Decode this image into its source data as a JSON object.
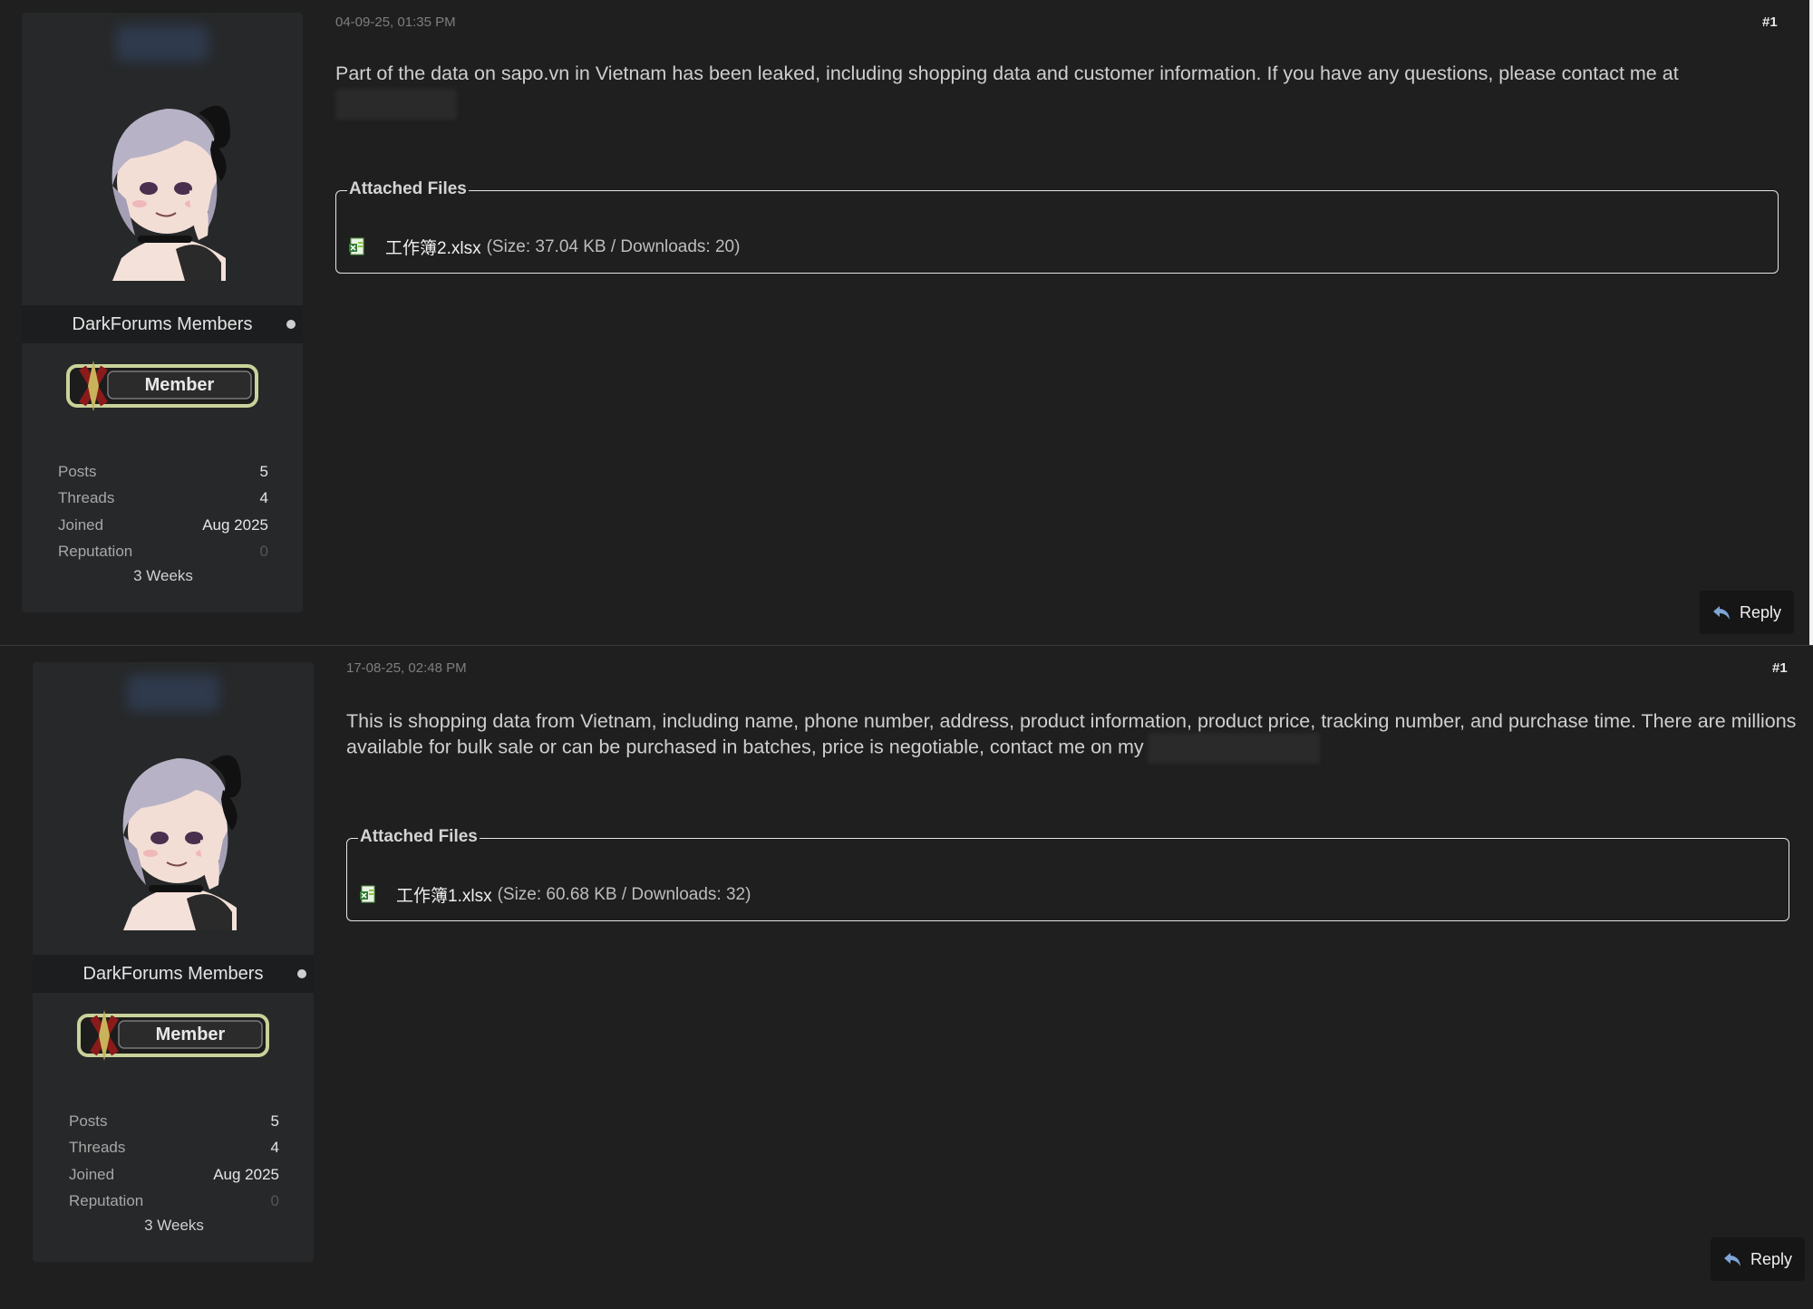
{
  "posts": [
    {
      "date": "04-09-25, 01:35 PM",
      "post_number": "#1",
      "content": "Part of the data on sapo.vn in Vietnam has been leaked, including shopping data and customer information. If you have any questions, please contact me at",
      "author": {
        "group": "DarkForums Members",
        "badge": "Member",
        "stats": [
          {
            "label": "Posts",
            "value": "5"
          },
          {
            "label": "Threads",
            "value": "4"
          },
          {
            "label": "Joined",
            "value": "Aug 2025"
          },
          {
            "label": "Reputation",
            "value": "0"
          }
        ],
        "joined_ago": "3 Weeks"
      },
      "attachments": {
        "legend": "Attached Files",
        "file_name": "工作簿2.xlsx",
        "file_meta": "(Size: 37.04 KB / Downloads: 20)"
      },
      "reply_label": "Reply"
    },
    {
      "date": "17-08-25, 02:48 PM",
      "post_number": "#1",
      "content": "This is shopping data from Vietnam, including name, phone number, address, product information, product price, tracking number, and purchase time.   There are millions available for bulk sale or can be purchased in batches, price is negotiable, contact me on my",
      "author": {
        "group": "DarkForums Members",
        "badge": "Member",
        "stats": [
          {
            "label": "Posts",
            "value": "5"
          },
          {
            "label": "Threads",
            "value": "4"
          },
          {
            "label": "Joined",
            "value": "Aug 2025"
          },
          {
            "label": "Reputation",
            "value": "0"
          }
        ],
        "joined_ago": "3 Weeks"
      },
      "attachments": {
        "legend": "Attached Files",
        "file_name": "工作簿1.xlsx",
        "file_meta": "(Size: 60.68 KB / Downloads: 32)"
      },
      "reply_label": "Reply"
    }
  ],
  "colors": {
    "background": "#1f1f1f",
    "sidebar": "#262829",
    "group_bar": "#1b1d1e",
    "text": "#cfcfcf",
    "muted": "#7e7e7e"
  },
  "icons": {
    "reply": "reply-arrow-icon",
    "file": "excel-file-icon",
    "online": "online-status-dot"
  }
}
